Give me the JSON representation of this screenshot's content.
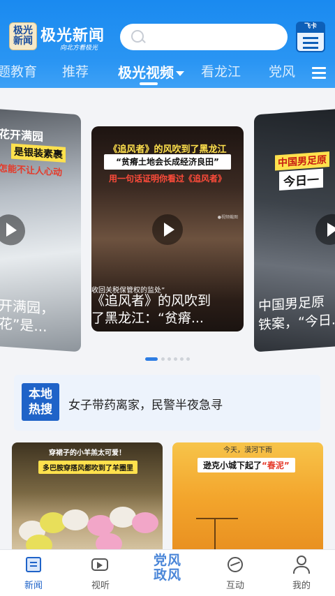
{
  "header": {
    "logo_line1": "极光",
    "logo_line2": "新闻",
    "app_title": "极光新闻",
    "slogan": "向北方看极光",
    "search_placeholder": "",
    "feika_label": "飞卡"
  },
  "tabs": [
    {
      "label": "题教育"
    },
    {
      "label": "推荐"
    },
    {
      "label": "极光视频"
    },
    {
      "label": "看龙江"
    },
    {
      "label": "党风"
    }
  ],
  "carousel": {
    "left": {
      "title1": "花开满园",
      "title2": "是银装素裹",
      "title3": "怎能不让人心动",
      "caption_line1": "开满园，",
      "caption_line2": "花”是..."
    },
    "center": {
      "line1": "《追风者》的风吹到了黑龙江",
      "line2": "“贫瘠土地会长成经济良田”",
      "line3": "用一句话证明你看过《追风者》",
      "watermark": "●视频截图",
      "subtitle": "收回关税保管权的监处”",
      "caption_line1": "《追风者》的风吹到",
      "caption_line2": "了黑龙江：“贫瘠..."
    },
    "right": {
      "title1": "中国男足原",
      "title2": "今日一",
      "caption_line1": "中国男足原",
      "caption_line2": "铁案，“今日..."
    },
    "dot_count": 6,
    "active_dot": 0
  },
  "hot_search": {
    "badge_line1": "本地",
    "badge_line2": "热搜",
    "text": "女子带药离家，民警半夜急寻"
  },
  "thumbs": {
    "left": {
      "line1": "穿裙子的小羊羔太可爱！",
      "line2": "多巴胺穿搭风都吹到了羊圈里"
    },
    "right": {
      "line1": "今天，漠河下雨",
      "line2_pre": "逊克小城下起了",
      "line2_em": "“春泥”"
    }
  },
  "bottom_nav": [
    {
      "label": "新闻",
      "icon": "news-icon",
      "active": true
    },
    {
      "label": "视听",
      "icon": "video-icon",
      "active": false
    },
    {
      "label": "互动",
      "icon": "interact-icon",
      "active": false
    },
    {
      "label": "我的",
      "icon": "profile-icon",
      "active": false
    }
  ],
  "center_logo": {
    "line1": "党风",
    "line2": "政风"
  },
  "colors": {
    "header_blue": "#1a8af0",
    "accent": "#1f63c8"
  }
}
